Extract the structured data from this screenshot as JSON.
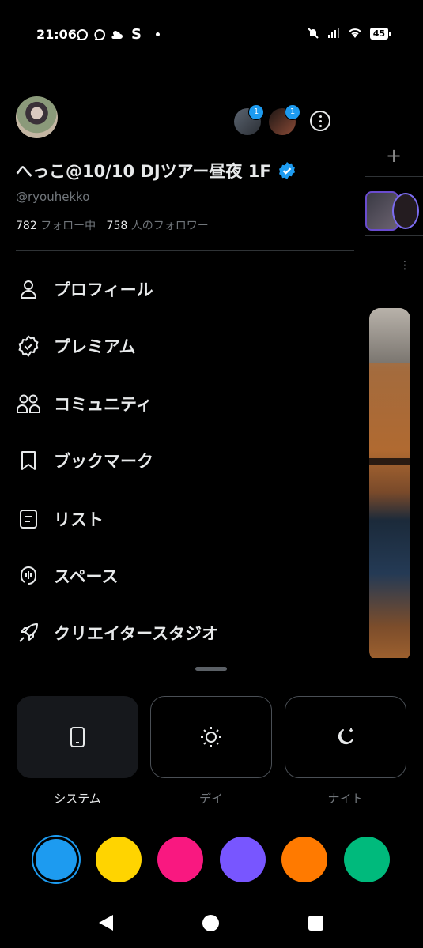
{
  "status_bar": {
    "time": "21:06",
    "app_letter": "S",
    "battery": "45"
  },
  "profile": {
    "name": "へっこ@10/10 DJツアー昼夜 1F",
    "handle": "@ryouhekko",
    "following_count": "782",
    "following_label": "フォロー中",
    "followers_count": "758",
    "followers_label": "人のフォロワー",
    "accounts": [
      {
        "badge": "1"
      },
      {
        "badge": "1"
      }
    ]
  },
  "menu": {
    "items": [
      {
        "label": "プロフィール",
        "icon": "person-icon"
      },
      {
        "label": "プレミアム",
        "icon": "verified-badge-icon"
      },
      {
        "label": "コミュニティ",
        "icon": "communities-icon"
      },
      {
        "label": "ブックマーク",
        "icon": "bookmark-icon"
      },
      {
        "label": "リスト",
        "icon": "list-icon"
      },
      {
        "label": "スペース",
        "icon": "spaces-icon"
      },
      {
        "label": "クリエイタースタジオ",
        "icon": "rocket-icon"
      }
    ]
  },
  "theme": {
    "options": [
      {
        "label": "システム",
        "icon": "phone-icon",
        "selected": true
      },
      {
        "label": "デイ",
        "icon": "sun-icon",
        "selected": false
      },
      {
        "label": "ナイト",
        "icon": "moon-icon",
        "selected": false
      }
    ]
  },
  "accent_colors": [
    "#1d9bf0",
    "#ffd400",
    "#f91880",
    "#7856ff",
    "#ff7a00",
    "#00ba7c"
  ],
  "selected_accent": "#1d9bf0"
}
